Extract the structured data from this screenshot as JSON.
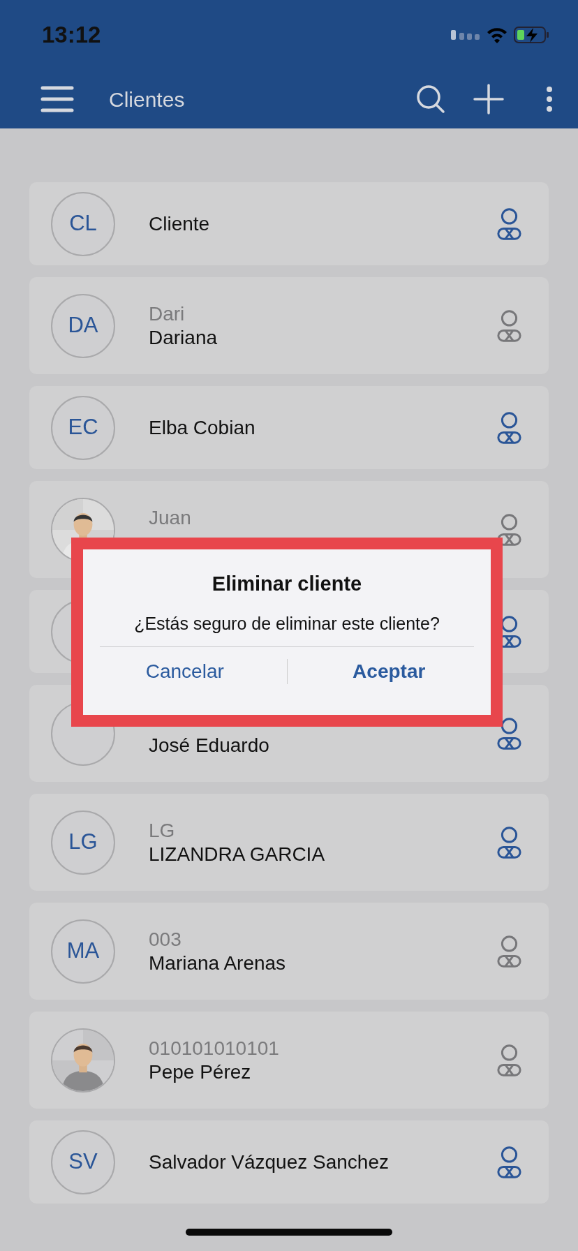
{
  "status_bar": {
    "time": "13:12"
  },
  "app_bar": {
    "title": "Clientes"
  },
  "clients": [
    {
      "kind": "one_line",
      "avatar": {
        "kind": "initials",
        "text": "CL"
      },
      "name": "Cliente",
      "active": true
    },
    {
      "kind": "two_line",
      "avatar": {
        "kind": "initials",
        "text": "DA"
      },
      "subtitle": "Dari",
      "name": "Dariana",
      "active": false
    },
    {
      "kind": "one_line",
      "avatar": {
        "kind": "initials",
        "text": "EC"
      },
      "name": "Elba Cobian",
      "active": true
    },
    {
      "kind": "two_line",
      "subtitle": "Juan",
      "active": false
    },
    {
      "kind": "one_line",
      "avatar": {
        "kind": "blank"
      },
      "active": true
    },
    {
      "kind": "two_line",
      "avatar": {
        "kind": "blank"
      },
      "name": "José Eduardo",
      "active": true
    },
    {
      "kind": "two_line",
      "avatar": {
        "kind": "initials",
        "text": "LG"
      },
      "subtitle": "LG",
      "name": "LIZANDRA GARCIA",
      "active": true
    },
    {
      "kind": "two_line",
      "avatar": {
        "kind": "initials",
        "text": "MA"
      },
      "subtitle": "003",
      "name": "Mariana Arenas",
      "active": false
    },
    {
      "kind": "two_line",
      "subtitle": "010101010101",
      "name": "Pepe Pérez",
      "active": false
    },
    {
      "kind": "one_line",
      "avatar": {
        "kind": "initials",
        "text": "SV"
      },
      "name": "Salvador Vázquez Sanchez",
      "active": true
    }
  ],
  "dialog": {
    "title": "Eliminar cliente",
    "message": "¿Estás seguro de eliminar este cliente?",
    "buttons": [
      {
        "label": "Cancelar",
        "primary": false
      },
      {
        "label": "Aceptar",
        "primary": true
      }
    ]
  }
}
